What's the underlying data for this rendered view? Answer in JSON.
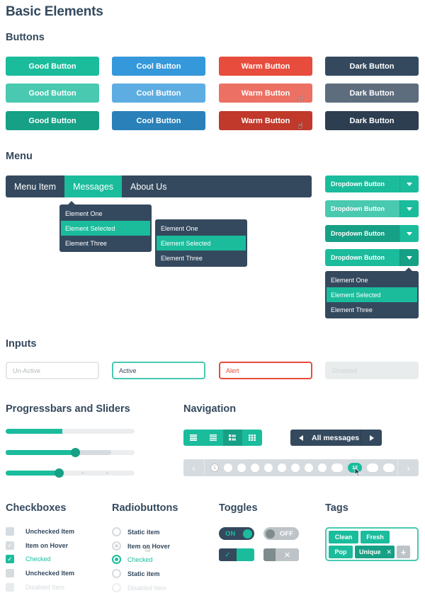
{
  "title": "Basic Elements",
  "colors": {
    "turquoise": "#1abc9c",
    "green_sea": "#16a085",
    "peter_river": "#3498db",
    "alizarin": "#e74c3c",
    "wet_asphalt": "#34495e",
    "silver": "#bdc3c7"
  },
  "buttons": {
    "heading": "Buttons",
    "states": [
      "normal",
      "hover",
      "active"
    ],
    "columns": [
      {
        "name": "good",
        "label": "Good Button"
      },
      {
        "name": "cool",
        "label": "Cool Button"
      },
      {
        "name": "warm",
        "label": "Warm Button"
      },
      {
        "name": "dark",
        "label": "Dark Button"
      }
    ],
    "labels": {
      "good": "Good Button",
      "cool": "Cool Button",
      "warm": "Warm Button",
      "dark": "Dark Button"
    }
  },
  "menu": {
    "heading": "Menu",
    "items": [
      "Menu Item",
      "Messages",
      "About Us"
    ],
    "selected": "Messages",
    "dropdown_1": {
      "items": [
        "Element One",
        "Element Selected",
        "Element Three"
      ],
      "selected": 1
    },
    "dropdown_2": {
      "items": [
        "Element One",
        "Element Selected",
        "Element Three"
      ],
      "selected": 1
    },
    "dropdown_buttons": {
      "label": "Dropdown Button",
      "states": [
        "normal",
        "hover",
        "active",
        "open"
      ],
      "menu": {
        "items": [
          "Element One",
          "Element Selected",
          "Element Three"
        ],
        "selected": 1
      }
    }
  },
  "inputs": {
    "heading": "Inputs",
    "fields": [
      {
        "state": "un-active",
        "placeholder": "Un-Active",
        "value": ""
      },
      {
        "state": "active",
        "placeholder": "",
        "value": "Active"
      },
      {
        "state": "alert",
        "placeholder": "",
        "value": "Alert"
      },
      {
        "state": "disabled",
        "placeholder": "Disabled",
        "value": ""
      }
    ]
  },
  "progress": {
    "heading": "Progressbars and Sliders",
    "progressbar_percent": 44,
    "slider_1": {
      "value_percent": 54,
      "buffer_percent": 82
    },
    "slider_2": {
      "value_percent": 41,
      "steps_percent": [
        59,
        78
      ]
    }
  },
  "navigation": {
    "heading": "Navigation",
    "view_buttons": [
      {
        "icon": "list-large-icon",
        "selected": false
      },
      {
        "icon": "list-icon",
        "selected": false
      },
      {
        "icon": "list-thumbs-icon",
        "selected": true
      },
      {
        "icon": "grid-icon",
        "selected": false
      }
    ],
    "message_nav": {
      "label": "All messages",
      "prev_icon": "triangle-left-icon",
      "next_icon": "triangle-right-icon"
    },
    "pager": {
      "prev_icon": "chevron-left-icon",
      "next_icon": "chevron-right-icon",
      "first_label": "1",
      "current_label": "12",
      "dot_count_before": 8,
      "wide_before": 1,
      "dot_count_after": 2
    }
  },
  "checkboxes": {
    "heading": "Checkboxes",
    "items": [
      {
        "label": "Unchecked Item",
        "state": "unchecked"
      },
      {
        "label": "Item on Hover",
        "state": "hover"
      },
      {
        "label": "Checked",
        "state": "checked"
      },
      {
        "label": "Unchecked Item",
        "state": "unchecked"
      },
      {
        "label": "Disabled Item",
        "state": "disabled"
      }
    ]
  },
  "radios": {
    "heading": "Radiobuttons",
    "items": [
      {
        "label": "Static item",
        "state": "static"
      },
      {
        "label": "Item on Hover",
        "state": "hover"
      },
      {
        "label": "Checked",
        "state": "checked"
      },
      {
        "label": "Static item",
        "state": "static"
      },
      {
        "label": "Disabled Item",
        "state": "disabled"
      }
    ]
  },
  "toggles": {
    "heading": "Toggles",
    "on_label": "ON",
    "off_label": "OFF",
    "check_icon": "✓",
    "cross_icon": "✕"
  },
  "tags": {
    "heading": "Tags",
    "items": [
      "Clean",
      "Fresh",
      "Pop",
      "Unique"
    ],
    "remove_icon": "✕",
    "add_icon": "+"
  }
}
